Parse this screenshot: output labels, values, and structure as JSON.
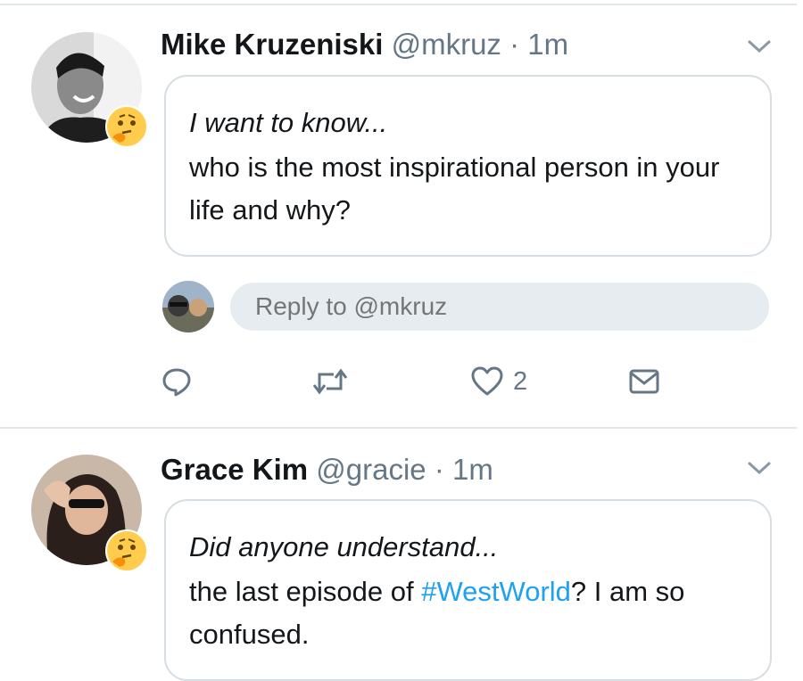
{
  "tweets": [
    {
      "name": "Mike Kruzeniski",
      "handle": "@mkruz",
      "separator": "·",
      "time": "1m",
      "intro": "I want to know...",
      "body": "who is the most inspirational person in your life and why?",
      "reply_placeholder": "Reply to @mkruz",
      "like_count": "2",
      "badge_icon": "thinking-face-emoji"
    },
    {
      "name": "Grace Kim",
      "handle": "@gracie",
      "separator": "·",
      "time": "1m",
      "intro": "Did anyone understand...",
      "body_before": "the last episode of ",
      "hashtag": "#WestWorld",
      "body_after": "? I am so confused.",
      "badge_icon": "thinking-face-emoji"
    }
  ],
  "colors": {
    "link": "#1da1f2",
    "secondary_text": "#657786",
    "border": "#e1e8ed",
    "reply_bg": "#e6ecf0"
  }
}
